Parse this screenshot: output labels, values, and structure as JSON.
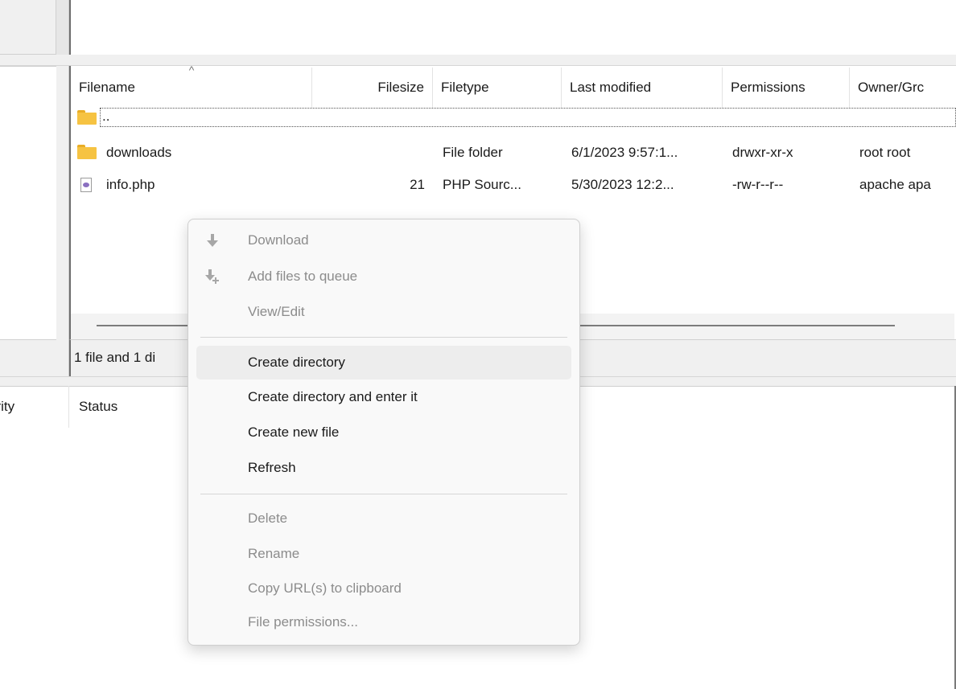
{
  "remote_list": {
    "sort_indicator": "^",
    "columns": [
      "Filename",
      "Filesize",
      "Filetype",
      "Last modified",
      "Permissions",
      "Owner/Grc"
    ],
    "rows": [
      {
        "name": "..",
        "size": "",
        "type": "",
        "modified": "",
        "permissions": "",
        "owner": "",
        "icon": "folder-icon"
      },
      {
        "name": "downloads",
        "size": "",
        "type": "File folder",
        "modified": "6/1/2023 9:57:1...",
        "permissions": "drwxr-xr-x",
        "owner": "root root",
        "icon": "folder-icon"
      },
      {
        "name": "info.php",
        "size": "21",
        "type": "PHP Sourc...",
        "modified": "5/30/2023 12:2...",
        "permissions": "-rw-r--r--",
        "owner": "apache apa",
        "icon": "php-file-icon"
      }
    ],
    "status": "1 file and 1 di"
  },
  "queue": {
    "columns": [
      "ority",
      "Status"
    ]
  },
  "context_menu": {
    "items": [
      {
        "label": "Download",
        "enabled": false,
        "icon": "download-arrow-icon"
      },
      {
        "label": "Add files to queue",
        "enabled": false,
        "icon": "add-to-queue-icon"
      },
      {
        "label": "View/Edit",
        "enabled": false
      },
      {
        "label": "Create directory",
        "enabled": true,
        "hover": true
      },
      {
        "label": "Create directory and enter it",
        "enabled": true
      },
      {
        "label": "Create new file",
        "enabled": true
      },
      {
        "label": "Refresh",
        "enabled": true
      },
      {
        "label": "Delete",
        "enabled": false
      },
      {
        "label": "Rename",
        "enabled": false
      },
      {
        "label": "Copy URL(s) to clipboard",
        "enabled": false
      },
      {
        "label": "File permissions...",
        "enabled": false
      }
    ]
  },
  "colors": {
    "folder": "#f6c342",
    "panel_bg": "#f0f0f0",
    "menu_bg": "#f9f9f9",
    "menu_hover": "#ededed",
    "disabled_text": "#8c8c8c"
  }
}
